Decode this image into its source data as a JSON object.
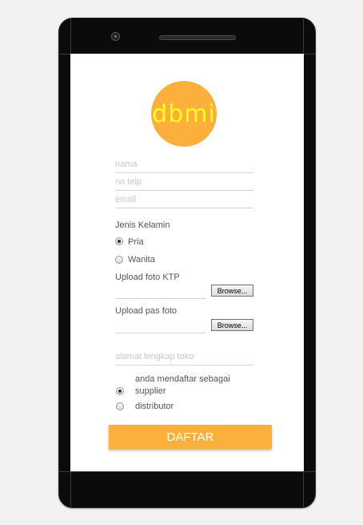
{
  "brand": {
    "logo_text": "dbmi",
    "accent_color": "#fbb03b",
    "logo_text_color": "#ffff1a"
  },
  "form": {
    "nama_placeholder": "nama",
    "telp_placeholder": "no telp",
    "email_placeholder": "email",
    "gender_label": "Jenis Kelamin",
    "gender_options": [
      {
        "label": "Pria",
        "checked": true
      },
      {
        "label": "Wanita",
        "checked": false
      }
    ],
    "ktp_label": "Upload foto KTP",
    "pasfoto_label": "Upload pas foto",
    "browse_label": "Browse...",
    "alamat_placeholder": "alamat lengkap toko",
    "role_label_line1": "anda mendaftar sebagai",
    "role_options": [
      {
        "label": "supplier",
        "checked": true
      },
      {
        "label": "distributor",
        "checked": false
      }
    ],
    "submit_label": "DAFTAR"
  }
}
